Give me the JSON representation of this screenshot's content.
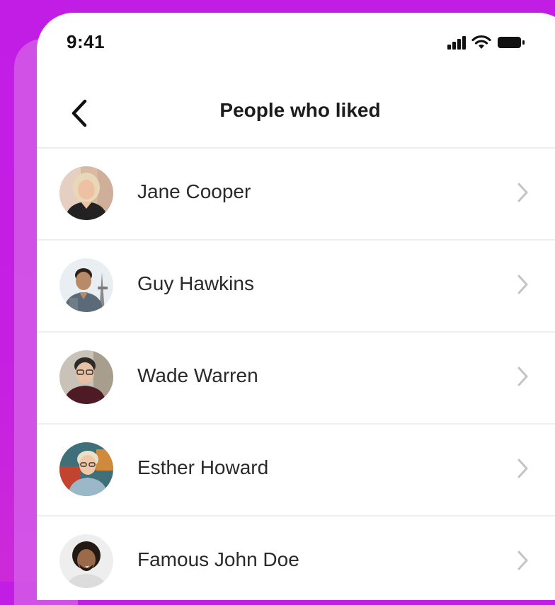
{
  "status_bar": {
    "time": "9:41",
    "icons": [
      "signal-icon",
      "wifi-icon",
      "battery-icon"
    ]
  },
  "nav": {
    "back_icon": "chevron-left-icon",
    "title": "People who liked"
  },
  "people": [
    {
      "name": "Jane Cooper",
      "icon": "chevron-right-icon"
    },
    {
      "name": "Guy Hawkins",
      "icon": "chevron-right-icon"
    },
    {
      "name": "Wade Warren",
      "icon": "chevron-right-icon"
    },
    {
      "name": "Esther Howard",
      "icon": "chevron-right-icon"
    },
    {
      "name": "Famous John Doe",
      "icon": "chevron-right-icon"
    }
  ],
  "colors": {
    "background": "#c51fe2",
    "card": "#ffffff",
    "text": "#2a2a2a",
    "chevron": "#c4c4c4",
    "divider": "#eeeeee"
  }
}
